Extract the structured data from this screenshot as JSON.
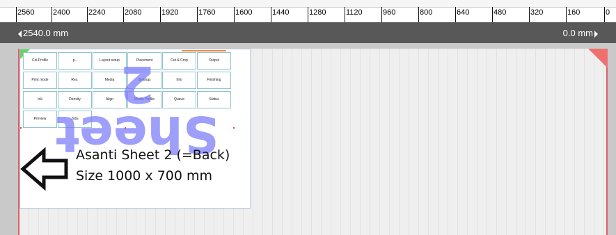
{
  "ruler": {
    "ticks": [
      "2560",
      "2400",
      "2240",
      "2080",
      "1920",
      "1760",
      "1600",
      "1440",
      "1280",
      "1120",
      "960",
      "800",
      "640",
      "480",
      "320",
      "160",
      "0"
    ]
  },
  "dimension_bar": {
    "left_value": "2540.0 mm",
    "right_value": "0.0 mm"
  },
  "thumbnail": {
    "watermark": "Sheet 2",
    "title": "Asanti Sheet 2 (=Back)",
    "size": "Size 1000 x 700 mm",
    "tiles": [
      "Col.Profile",
      "p..",
      "Layout setup",
      "Placement",
      "Cut & Crop",
      "Output",
      "Print mode",
      "Res.",
      "Media",
      "Settings",
      "Info",
      "Finishing",
      "Ink",
      "Density",
      "Align",
      "Media Profile",
      "Queue",
      "Status",
      "Preview",
      "Jobs"
    ]
  },
  "colors": {
    "dimension_bar_bg": "#585858",
    "watermark": "#7878fa",
    "tile_border": "#8fc3cf",
    "margin_line": "#e06060",
    "corner_green": "#64d464",
    "corner_red": "#f07070"
  },
  "icons": {
    "back_arrow": "arrow-left-outline-icon",
    "dim_left": "caret-left-icon",
    "dim_right": "caret-right-icon"
  }
}
